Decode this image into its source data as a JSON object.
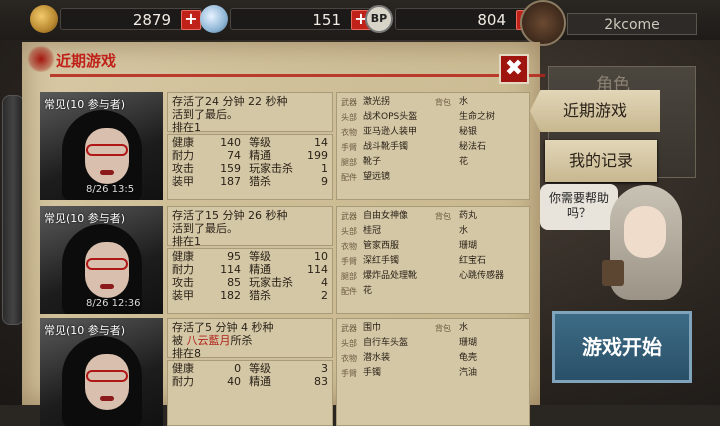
{
  "resources": {
    "gold": {
      "value": "2879",
      "icon": "coin-stack-icon"
    },
    "crystal": {
      "value": "151",
      "icon": "crystal-icon"
    },
    "bp": {
      "label": "BP",
      "value": "804",
      "icon": "bp-badge-icon"
    },
    "plus": "+"
  },
  "user": {
    "name": "2kcome"
  },
  "panel": {
    "title": "近期游戏",
    "close": "✖"
  },
  "labels": {
    "alive": "存活了",
    "minutes": "分钟",
    "seconds": "秒种",
    "rank_prefix": "排在"
  },
  "records": [
    {
      "mode": "常见(10 参与者)",
      "date": "8/26 13:5",
      "alive_min": "24",
      "alive_sec": "22",
      "outcome": "活到了最后。",
      "rank": "1",
      "stats": [
        [
          "健康",
          "140",
          "等级",
          "14"
        ],
        [
          "耐力",
          "74",
          "精通",
          "199"
        ],
        [
          "攻击",
          "159",
          "玩家击杀",
          "1"
        ],
        [
          "装甲",
          "187",
          "猎杀",
          "9"
        ]
      ],
      "equip": [
        [
          "武器",
          "激光拐",
          "背包",
          "水"
        ],
        [
          "头部",
          "战术OPS头盔",
          "",
          "生命之树"
        ],
        [
          "衣物",
          "亚马逊人装甲",
          "",
          "秘银"
        ],
        [
          "手臂",
          "战斗靴手镯",
          "",
          "秘法石"
        ],
        [
          "腿部",
          "靴子",
          "",
          "花"
        ],
        [
          "配件",
          "望远镜",
          "",
          ""
        ]
      ]
    },
    {
      "mode": "常见(10 参与者)",
      "date": "8/26 12:36",
      "alive_min": "15",
      "alive_sec": "26",
      "outcome": "活到了最后。",
      "rank": "1",
      "stats": [
        [
          "健康",
          "95",
          "等级",
          "10"
        ],
        [
          "耐力",
          "114",
          "精通",
          "114"
        ],
        [
          "攻击",
          "85",
          "玩家击杀",
          "4"
        ],
        [
          "装甲",
          "182",
          "猎杀",
          "2"
        ]
      ],
      "equip": [
        [
          "武器",
          "自由女神像",
          "背包",
          "药丸"
        ],
        [
          "头部",
          "桂冠",
          "",
          "水"
        ],
        [
          "衣物",
          "管家西服",
          "",
          "珊瑚"
        ],
        [
          "手臂",
          "深红手镯",
          "",
          "红宝石"
        ],
        [
          "腿部",
          "爆炸品处理靴",
          "",
          "心跳传感器"
        ],
        [
          "配件",
          "花",
          "",
          ""
        ]
      ]
    },
    {
      "mode": "常见(10 参与者)",
      "date": "",
      "alive_min": "5",
      "alive_sec": "4",
      "outcome_prefix": "被",
      "killer": "八云藍月",
      "outcome_suffix": "所杀",
      "rank": "8",
      "stats": [
        [
          "健康",
          "0",
          "等级",
          "3"
        ],
        [
          "耐力",
          "40",
          "精通",
          "83"
        ]
      ],
      "equip": [
        [
          "武器",
          "围巾",
          "背包",
          "水"
        ],
        [
          "头部",
          "自行车头盔",
          "",
          "珊瑚"
        ],
        [
          "衣物",
          "潜水装",
          "",
          "龟壳"
        ],
        [
          "手臂",
          "手镯",
          "",
          "汽油"
        ]
      ]
    }
  ],
  "tabs": {
    "ghost": "角色",
    "recent": "近期游戏",
    "records": "我的记录"
  },
  "help": {
    "text": "你需要帮助吗？"
  },
  "start": {
    "label": "游戏开始"
  }
}
